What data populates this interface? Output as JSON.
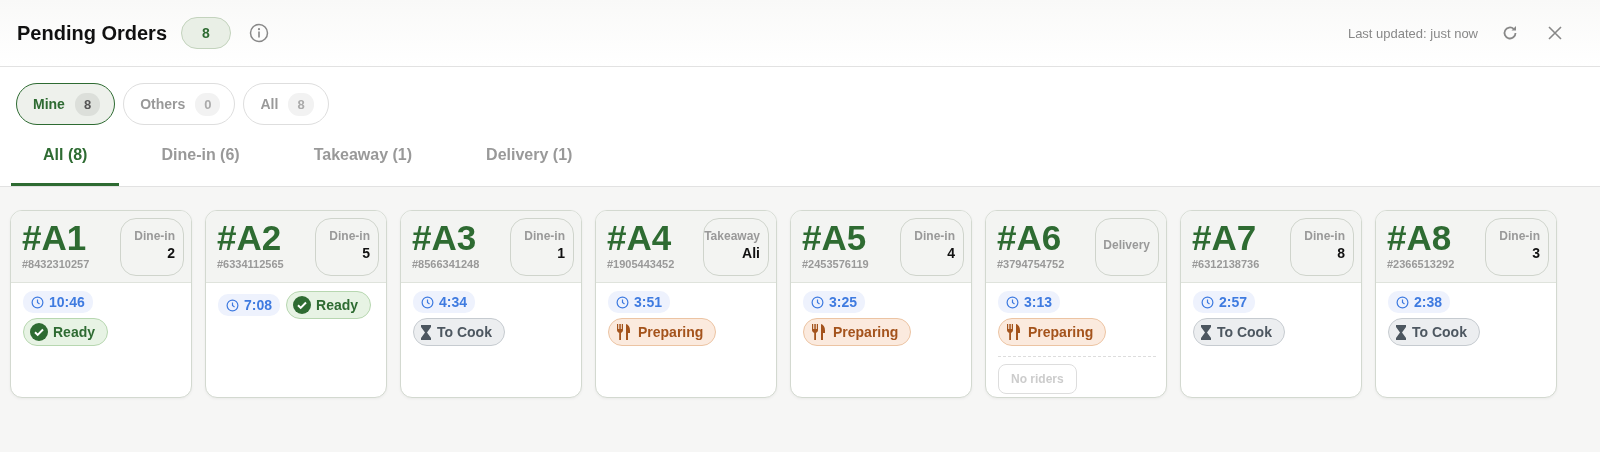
{
  "header": {
    "title": "Pending Orders",
    "count": "8",
    "last_updated": "Last updated: just now"
  },
  "owner_filters": [
    {
      "label": "Mine",
      "count": "8",
      "selected": true
    },
    {
      "label": "Others",
      "count": "0",
      "selected": false
    },
    {
      "label": "All",
      "count": "8",
      "selected": false
    }
  ],
  "tabs": [
    {
      "label": "All (8)",
      "selected": true
    },
    {
      "label": "Dine-in (6)",
      "selected": false
    },
    {
      "label": "Takeaway (1)",
      "selected": false
    },
    {
      "label": "Delivery (1)",
      "selected": false
    }
  ],
  "orders": [
    {
      "number": "#A1",
      "reference": "#8432310257",
      "type": "Dine-in",
      "detail": "2",
      "timer": "10:46",
      "status": {
        "kind": "ready",
        "label": "Ready"
      }
    },
    {
      "number": "#A2",
      "reference": "#6334112565",
      "type": "Dine-in",
      "detail": "5",
      "timer": "7:08",
      "status": {
        "kind": "ready",
        "label": "Ready"
      }
    },
    {
      "number": "#A3",
      "reference": "#8566341248",
      "type": "Dine-in",
      "detail": "1",
      "timer": "4:34",
      "status": {
        "kind": "to_cook",
        "label": "To Cook"
      }
    },
    {
      "number": "#A4",
      "reference": "#1905443452",
      "type": "Takeaway",
      "detail": "Ali",
      "timer": "3:51",
      "status": {
        "kind": "preparing",
        "label": "Preparing"
      }
    },
    {
      "number": "#A5",
      "reference": "#2453576119",
      "type": "Dine-in",
      "detail": "4",
      "timer": "3:25",
      "status": {
        "kind": "preparing",
        "label": "Preparing"
      }
    },
    {
      "number": "#A6",
      "reference": "#3794754752",
      "type": "Delivery",
      "timer": "3:13",
      "status": {
        "kind": "preparing",
        "label": "Preparing"
      },
      "rider": "No riders"
    },
    {
      "number": "#A7",
      "reference": "#6312138736",
      "type": "Dine-in",
      "detail": "8",
      "timer": "2:57",
      "status": {
        "kind": "to_cook",
        "label": "To Cook"
      }
    },
    {
      "number": "#A8",
      "reference": "#2366513292",
      "type": "Dine-in",
      "detail": "3",
      "timer": "2:38",
      "status": {
        "kind": "to_cook",
        "label": "To Cook"
      }
    }
  ]
}
